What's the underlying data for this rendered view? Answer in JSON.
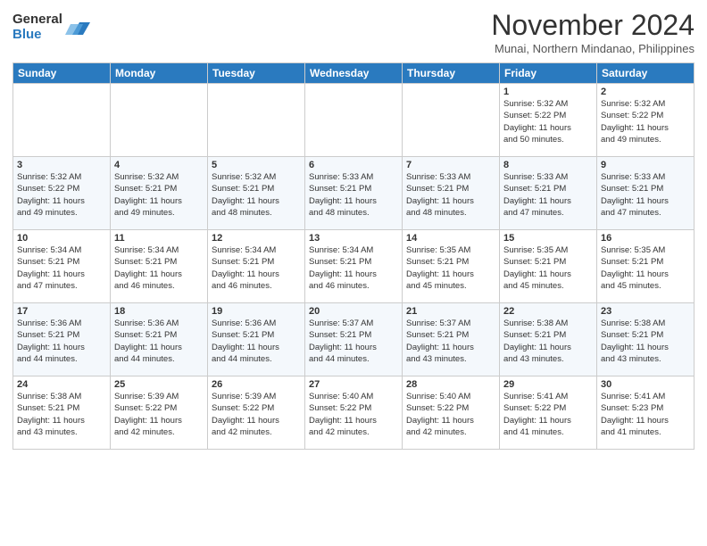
{
  "logo": {
    "general": "General",
    "blue": "Blue"
  },
  "header": {
    "month": "November 2024",
    "location": "Munai, Northern Mindanao, Philippines"
  },
  "days_of_week": [
    "Sunday",
    "Monday",
    "Tuesday",
    "Wednesday",
    "Thursday",
    "Friday",
    "Saturday"
  ],
  "weeks": [
    [
      {
        "day": "",
        "info": ""
      },
      {
        "day": "",
        "info": ""
      },
      {
        "day": "",
        "info": ""
      },
      {
        "day": "",
        "info": ""
      },
      {
        "day": "",
        "info": ""
      },
      {
        "day": "1",
        "info": "Sunrise: 5:32 AM\nSunset: 5:22 PM\nDaylight: 11 hours\nand 50 minutes."
      },
      {
        "day": "2",
        "info": "Sunrise: 5:32 AM\nSunset: 5:22 PM\nDaylight: 11 hours\nand 49 minutes."
      }
    ],
    [
      {
        "day": "3",
        "info": "Sunrise: 5:32 AM\nSunset: 5:22 PM\nDaylight: 11 hours\nand 49 minutes."
      },
      {
        "day": "4",
        "info": "Sunrise: 5:32 AM\nSunset: 5:21 PM\nDaylight: 11 hours\nand 49 minutes."
      },
      {
        "day": "5",
        "info": "Sunrise: 5:32 AM\nSunset: 5:21 PM\nDaylight: 11 hours\nand 48 minutes."
      },
      {
        "day": "6",
        "info": "Sunrise: 5:33 AM\nSunset: 5:21 PM\nDaylight: 11 hours\nand 48 minutes."
      },
      {
        "day": "7",
        "info": "Sunrise: 5:33 AM\nSunset: 5:21 PM\nDaylight: 11 hours\nand 48 minutes."
      },
      {
        "day": "8",
        "info": "Sunrise: 5:33 AM\nSunset: 5:21 PM\nDaylight: 11 hours\nand 47 minutes."
      },
      {
        "day": "9",
        "info": "Sunrise: 5:33 AM\nSunset: 5:21 PM\nDaylight: 11 hours\nand 47 minutes."
      }
    ],
    [
      {
        "day": "10",
        "info": "Sunrise: 5:34 AM\nSunset: 5:21 PM\nDaylight: 11 hours\nand 47 minutes."
      },
      {
        "day": "11",
        "info": "Sunrise: 5:34 AM\nSunset: 5:21 PM\nDaylight: 11 hours\nand 46 minutes."
      },
      {
        "day": "12",
        "info": "Sunrise: 5:34 AM\nSunset: 5:21 PM\nDaylight: 11 hours\nand 46 minutes."
      },
      {
        "day": "13",
        "info": "Sunrise: 5:34 AM\nSunset: 5:21 PM\nDaylight: 11 hours\nand 46 minutes."
      },
      {
        "day": "14",
        "info": "Sunrise: 5:35 AM\nSunset: 5:21 PM\nDaylight: 11 hours\nand 45 minutes."
      },
      {
        "day": "15",
        "info": "Sunrise: 5:35 AM\nSunset: 5:21 PM\nDaylight: 11 hours\nand 45 minutes."
      },
      {
        "day": "16",
        "info": "Sunrise: 5:35 AM\nSunset: 5:21 PM\nDaylight: 11 hours\nand 45 minutes."
      }
    ],
    [
      {
        "day": "17",
        "info": "Sunrise: 5:36 AM\nSunset: 5:21 PM\nDaylight: 11 hours\nand 44 minutes."
      },
      {
        "day": "18",
        "info": "Sunrise: 5:36 AM\nSunset: 5:21 PM\nDaylight: 11 hours\nand 44 minutes."
      },
      {
        "day": "19",
        "info": "Sunrise: 5:36 AM\nSunset: 5:21 PM\nDaylight: 11 hours\nand 44 minutes."
      },
      {
        "day": "20",
        "info": "Sunrise: 5:37 AM\nSunset: 5:21 PM\nDaylight: 11 hours\nand 44 minutes."
      },
      {
        "day": "21",
        "info": "Sunrise: 5:37 AM\nSunset: 5:21 PM\nDaylight: 11 hours\nand 43 minutes."
      },
      {
        "day": "22",
        "info": "Sunrise: 5:38 AM\nSunset: 5:21 PM\nDaylight: 11 hours\nand 43 minutes."
      },
      {
        "day": "23",
        "info": "Sunrise: 5:38 AM\nSunset: 5:21 PM\nDaylight: 11 hours\nand 43 minutes."
      }
    ],
    [
      {
        "day": "24",
        "info": "Sunrise: 5:38 AM\nSunset: 5:21 PM\nDaylight: 11 hours\nand 43 minutes."
      },
      {
        "day": "25",
        "info": "Sunrise: 5:39 AM\nSunset: 5:22 PM\nDaylight: 11 hours\nand 42 minutes."
      },
      {
        "day": "26",
        "info": "Sunrise: 5:39 AM\nSunset: 5:22 PM\nDaylight: 11 hours\nand 42 minutes."
      },
      {
        "day": "27",
        "info": "Sunrise: 5:40 AM\nSunset: 5:22 PM\nDaylight: 11 hours\nand 42 minutes."
      },
      {
        "day": "28",
        "info": "Sunrise: 5:40 AM\nSunset: 5:22 PM\nDaylight: 11 hours\nand 42 minutes."
      },
      {
        "day": "29",
        "info": "Sunrise: 5:41 AM\nSunset: 5:22 PM\nDaylight: 11 hours\nand 41 minutes."
      },
      {
        "day": "30",
        "info": "Sunrise: 5:41 AM\nSunset: 5:23 PM\nDaylight: 11 hours\nand 41 minutes."
      }
    ]
  ]
}
